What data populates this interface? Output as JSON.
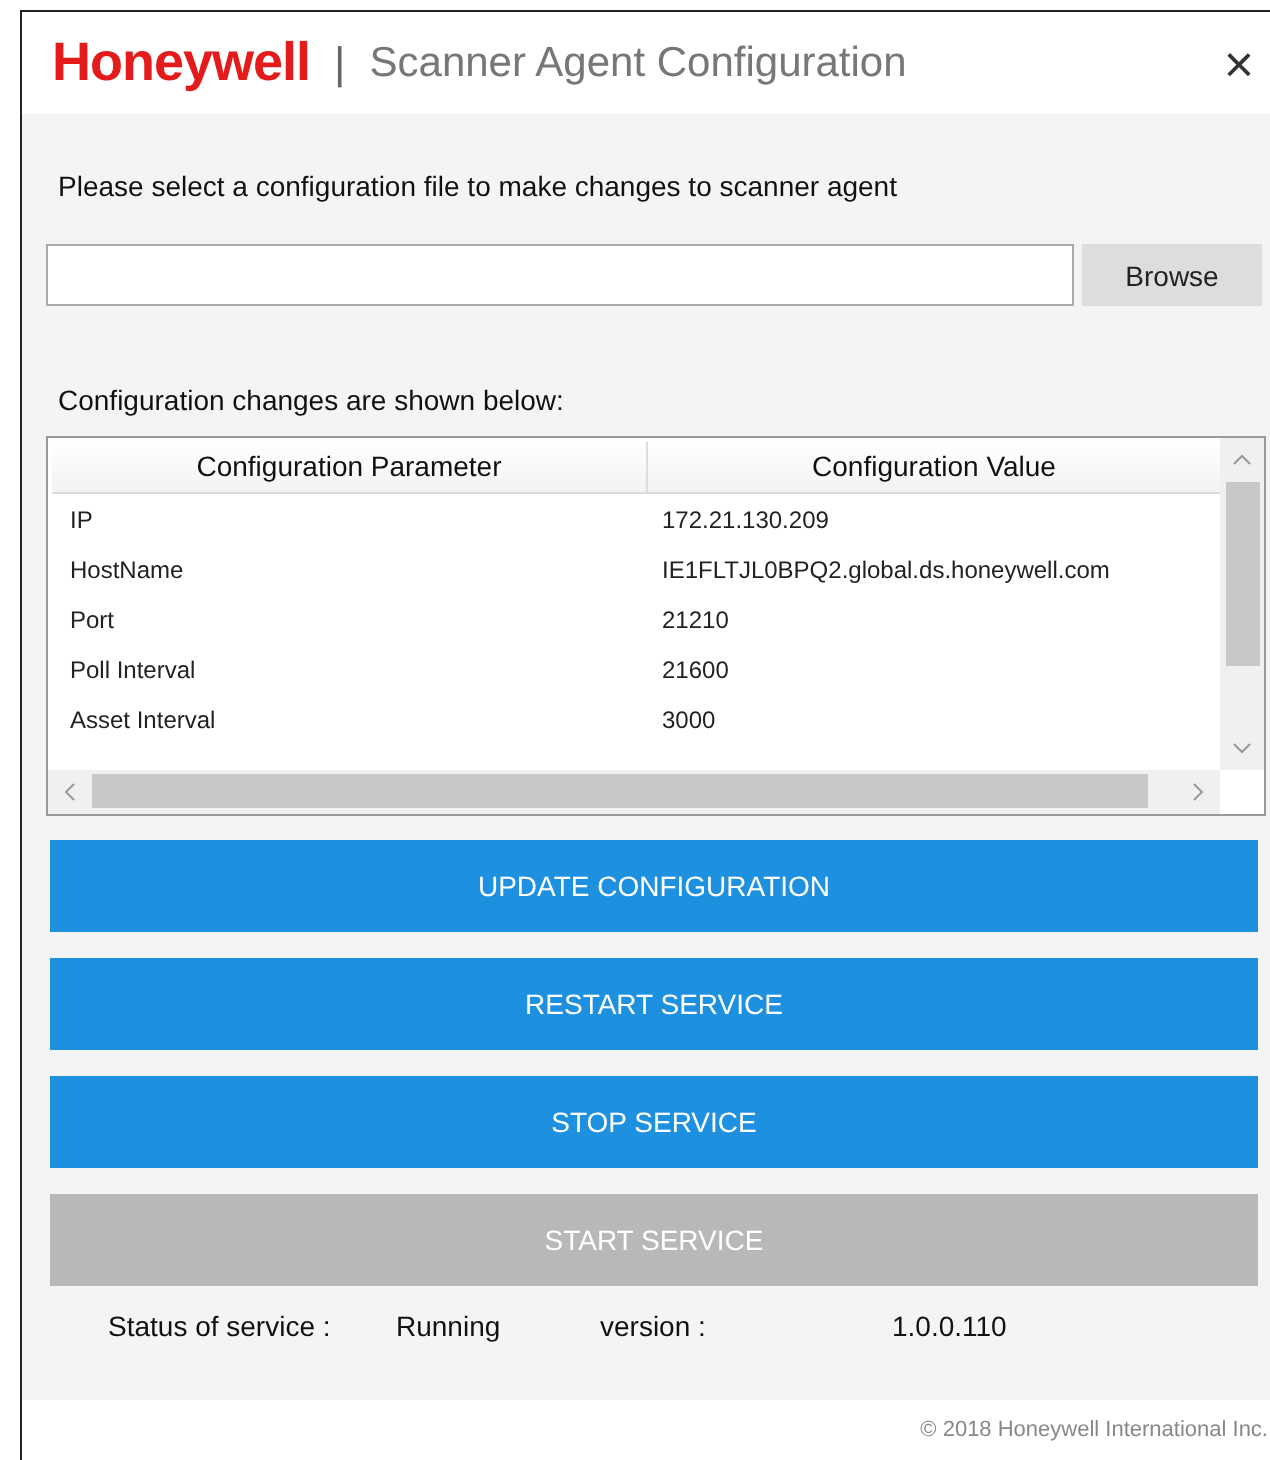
{
  "window": {
    "brand": "Honeywell",
    "separator": "|",
    "title": "Scanner Agent Configuration",
    "close": "×"
  },
  "instruction": "Please select a configuration file to make changes to scanner agent",
  "browse_button": "Browse",
  "changes_label": "Configuration changes are shown below:",
  "table": {
    "columns": [
      "Configuration Parameter",
      "Configuration Value"
    ],
    "rows": [
      [
        "IP",
        "172.21.130.209"
      ],
      [
        "HostName",
        "IE1FLTJL0BPQ2.global.ds.honeywell.com"
      ],
      [
        "Port",
        "21210"
      ],
      [
        "Poll Interval",
        "21600"
      ],
      [
        "Asset Interval",
        "3000"
      ]
    ]
  },
  "buttons": [
    {
      "label": "UPDATE CONFIGURATION",
      "disabled": false
    },
    {
      "label": "RESTART SERVICE",
      "disabled": false
    },
    {
      "label": "STOP SERVICE",
      "disabled": false
    },
    {
      "label": "START SERVICE",
      "disabled": true
    }
  ],
  "status": {
    "label": "Status of service :",
    "value": "Running",
    "version_label": "version :",
    "version": "1.0.0.110"
  },
  "footer": "© 2018 Honeywell International Inc."
}
